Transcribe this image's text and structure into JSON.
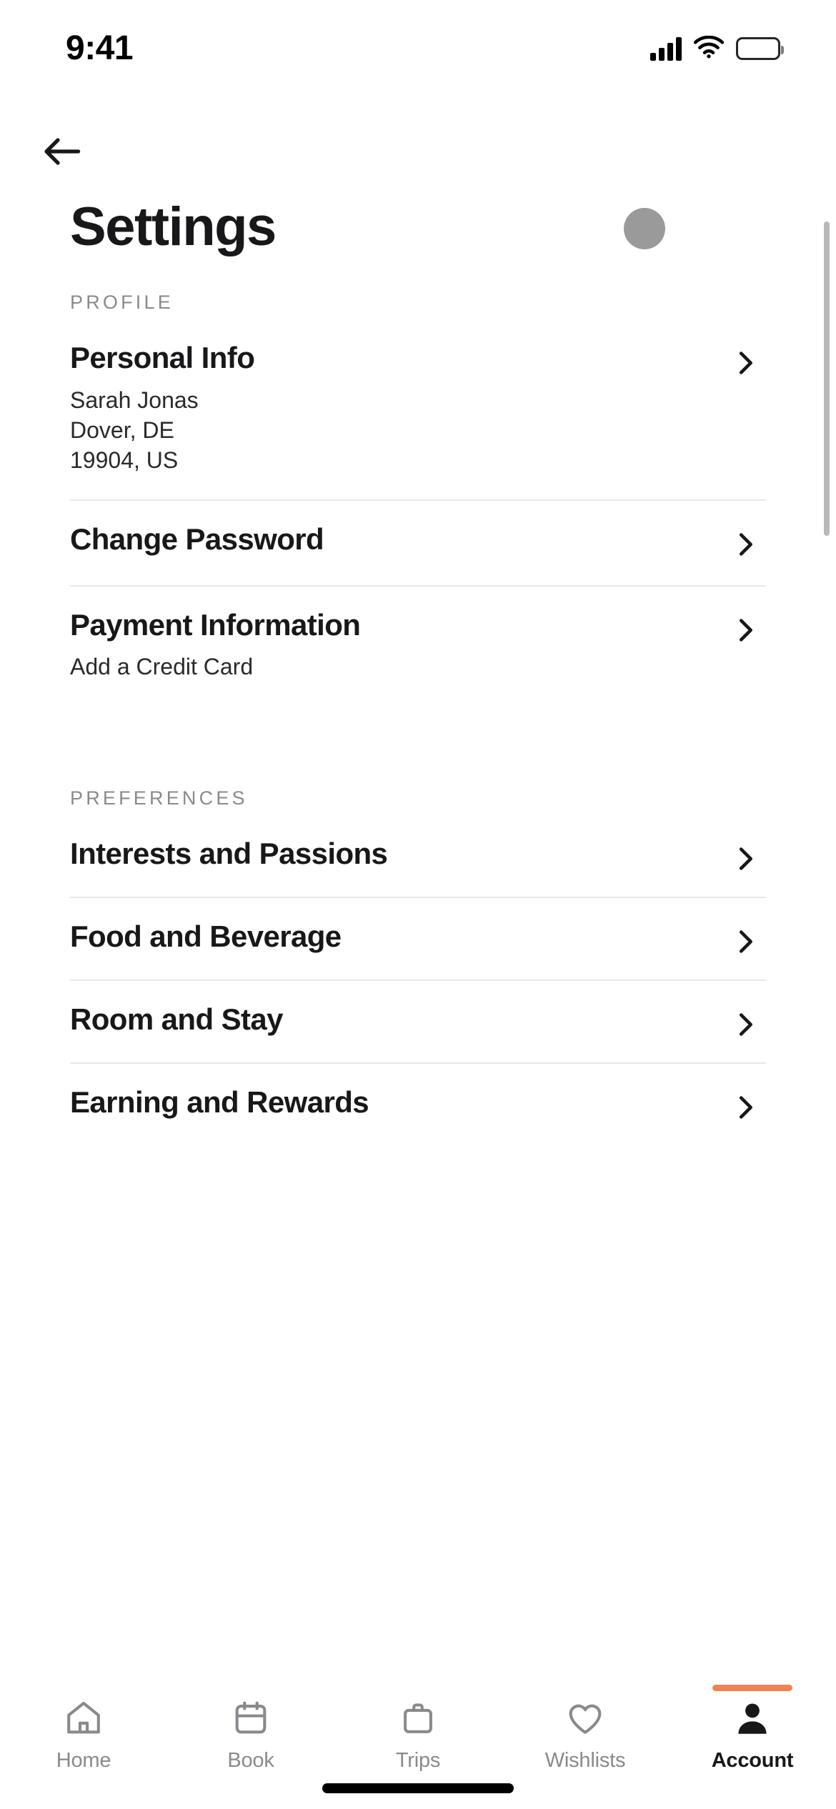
{
  "status_bar": {
    "time": "9:41",
    "cellular_icon": "cellular-signal-icon",
    "wifi_icon": "wifi-icon",
    "battery_icon": "battery-full-icon"
  },
  "nav": {
    "back_icon": "arrow-left-icon"
  },
  "header": {
    "title": "Settings"
  },
  "sections": [
    {
      "id": "profile",
      "header": "PROFILE",
      "rows": [
        {
          "title": "Personal Info",
          "sublines": [
            "Sarah Jonas",
            "Dover, DE",
            "19904, US"
          ],
          "chevron_icon": "chevron-right-icon"
        },
        {
          "title": "Change Password",
          "sublines": [],
          "chevron_icon": "chevron-right-icon"
        },
        {
          "title": "Payment Information",
          "sublines": [
            "Add a Credit Card"
          ],
          "chevron_icon": "chevron-right-icon"
        }
      ]
    },
    {
      "id": "preferences",
      "header": "PREFERENCES",
      "rows": [
        {
          "title": "Interests and Passions",
          "sublines": [],
          "chevron_icon": "chevron-right-icon"
        },
        {
          "title": "Food and Beverage",
          "sublines": [],
          "chevron_icon": "chevron-right-icon"
        },
        {
          "title": "Room and Stay",
          "sublines": [],
          "chevron_icon": "chevron-right-icon"
        },
        {
          "title": "Earning and Rewards",
          "sublines": [],
          "chevron_icon": "chevron-right-icon"
        }
      ]
    }
  ],
  "tab_bar": {
    "active_index": 4,
    "active_indicator_color": "#ef8354",
    "tabs": [
      {
        "label": "Home",
        "icon": "home-icon"
      },
      {
        "label": "Book",
        "icon": "calendar-icon"
      },
      {
        "label": "Trips",
        "icon": "briefcase-icon"
      },
      {
        "label": "Wishlists",
        "icon": "heart-icon"
      },
      {
        "label": "Account",
        "icon": "person-filled-icon"
      }
    ]
  },
  "overlays": {
    "touch_indicator": "touch-point-indicator",
    "scrollbar": "vertical-scrollbar"
  }
}
